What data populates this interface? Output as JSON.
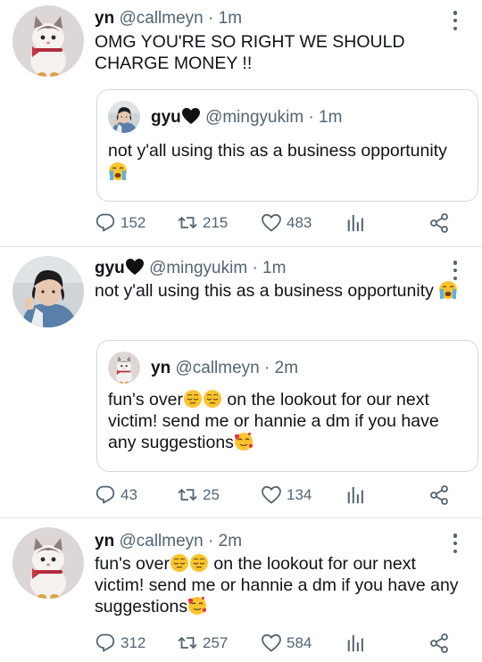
{
  "tweets": [
    {
      "name": "yn",
      "handle": "@callmeyn",
      "time": "· 1m",
      "text": "OMG YOU'RE SO RIGHT WE SHOULD CHARGE MONEY !!",
      "avatar": "cat-avatar",
      "quote": {
        "name": "gyu",
        "handle": "@mingyukim",
        "time": "· 1m",
        "text": "not y'all using this as a business opportunity",
        "emoji": "crying-face-emoji"
      },
      "stats": {
        "replies": "152",
        "retweets": "215",
        "likes": "483"
      }
    },
    {
      "name": "gyu",
      "handle": "@mingyukim",
      "time": "· 1m",
      "text": "not y'all using this as a business opportunity",
      "avatar": "person-avatar",
      "emoji": "crying-face-emoji",
      "quote": {
        "name": "yn",
        "handle": "@callmeyn",
        "time": "· 2m",
        "text_a": "fun's over",
        "text_b": " on the lookout for our next victim! send me or hannie a dm if you have any suggestions"
      },
      "stats": {
        "replies": "43",
        "retweets": "25",
        "likes": "134"
      }
    },
    {
      "name": "yn",
      "handle": "@callmeyn",
      "time": "· 2m",
      "text_a": "fun's over",
      "text_b": " on the lookout for our next victim! send me or hannie a dm if you have any suggestions",
      "avatar": "cat-avatar",
      "stats": {
        "replies": "312",
        "retweets": "257",
        "likes": "584"
      }
    }
  ],
  "icons": {
    "reply": "reply-icon",
    "retweet": "retweet-icon",
    "like": "heart-icon",
    "analytics": "analytics-icon",
    "share": "share-icon",
    "more": "more-options-icon"
  },
  "colors": {
    "text": "#0f1419",
    "secondary": "#536471",
    "border": "#cfd9de"
  }
}
